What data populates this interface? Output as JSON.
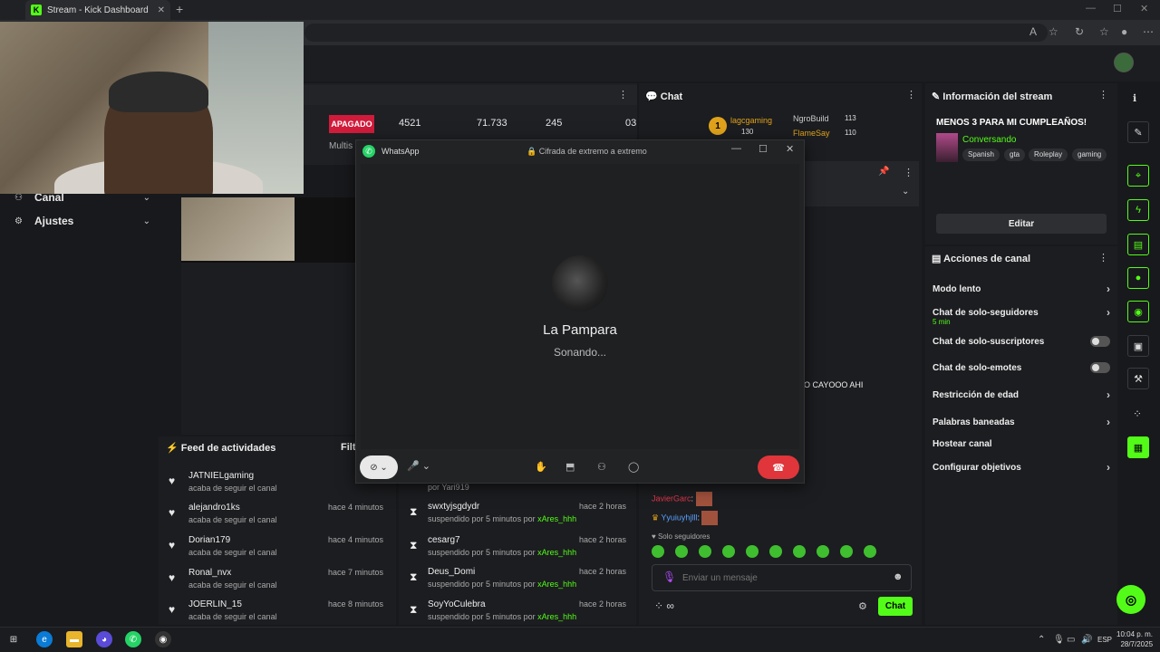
{
  "browser": {
    "tab_title": "Stream - Kick Dashboard",
    "tab_close": "✕",
    "new_tab": "+",
    "win_min": "—",
    "win_max": "☐",
    "win_close": "✕",
    "tool_icons": [
      "A",
      "☆",
      "↻",
      "☆",
      "●",
      "⋯"
    ]
  },
  "sidebar": {
    "items": [
      {
        "icon": "user-group-icon",
        "glyph": "⚇",
        "label": "Canal",
        "chevron": "⌄"
      },
      {
        "icon": "gear-icon",
        "glyph": "⚙",
        "label": "Ajustes",
        "chevron": "⌄"
      }
    ]
  },
  "stream_strip": {
    "status": "APAGADO",
    "multi": "Multis",
    "stats": [
      "4521",
      "71.733",
      "245",
      "03"
    ],
    "edge_letter": "e"
  },
  "activity_feed": {
    "title": "Feed de actividades",
    "filter": "Filt",
    "items": [
      {
        "name": "JATNIELgaming",
        "sub": "acaba de seguir el canal",
        "time": "hace"
      },
      {
        "name": "alejandro1ks",
        "sub": "acaba de seguir el canal",
        "time": "hace 4 minutos"
      },
      {
        "name": "Dorian179",
        "sub": "acaba de seguir el canal",
        "time": "hace 4 minutos"
      },
      {
        "name": "Ronal_nvx",
        "sub": "acaba de seguir el canal",
        "time": "hace 7 minutos"
      },
      {
        "name": "JOERLIN_15",
        "sub": "acaba de seguir el canal",
        "time": "hace 8 minutos"
      }
    ]
  },
  "mod_feed": {
    "partial": "por Yari919",
    "items": [
      {
        "name": "swxtyjsgdydr",
        "sub": "suspendido por 5 minutos por ",
        "by": "xAres_hhh",
        "time": "hace 2 horas"
      },
      {
        "name": "cesarg7",
        "sub": "suspendido por 5 minutos por ",
        "by": "xAres_hhh",
        "time": "hace 2 horas"
      },
      {
        "name": "Deus_Domi",
        "sub": "suspendido por 5 minutos por ",
        "by": "xAres_hhh",
        "time": "hace 2 horas"
      },
      {
        "name": "SoyYoCulebra",
        "sub": "suspendido por 5 minutos por ",
        "by": "xAres_hhh",
        "time": "hace 2 horas"
      }
    ]
  },
  "chat": {
    "title": "Chat",
    "leaderboard": [
      {
        "name": "lagcgaming",
        "count": "130"
      },
      {
        "name": "NgroBuild",
        "count": "113"
      },
      {
        "name": "FlameSay",
        "count": "110"
      }
    ],
    "rank_badge": "1",
    "message_fragment": "O CAYOOO AHI",
    "lines": [
      {
        "user": "JavierGarc",
        "text": ":"
      },
      {
        "user": "Yyuiuyhjlll",
        "text": ":"
      }
    ],
    "solo": "♥ Solo seguidores",
    "input_placeholder": "Enviar un mensaje",
    "send_label": "Chat",
    "infinity": "∞",
    "colors": {
      "accent": "#53fc18",
      "javier": "#e0354b",
      "yyu": "#5aa0ff"
    }
  },
  "stream_info": {
    "title": "Información del stream",
    "stream_title": "MENOS 3 PARA MI CUMPLEAÑOS!",
    "category": "Conversando",
    "tags": [
      "Spanish",
      "gta",
      "Roleplay",
      "gaming"
    ],
    "edit_label": "Editar"
  },
  "channel_actions": {
    "title": "Acciones de canal",
    "items": [
      {
        "label": "Modo lento",
        "control": "chevron"
      },
      {
        "label": "Chat de solo-seguidores",
        "control": "chevron",
        "note": "5 min"
      },
      {
        "label": "Chat de solo-suscriptores",
        "control": "toggle"
      },
      {
        "label": "Chat de solo-emotes",
        "control": "toggle"
      },
      {
        "label": "Restricción de edad",
        "control": "chevron"
      },
      {
        "label": "Palabras baneadas",
        "control": "chevron"
      },
      {
        "label": "Hostear canal",
        "control": "none"
      },
      {
        "label": "Configurar objetivos",
        "control": "chevron"
      }
    ]
  },
  "rail": {
    "icons": [
      {
        "name": "info-icon",
        "glyph": "ℹ"
      },
      {
        "name": "pencil-icon",
        "glyph": "✎"
      },
      {
        "name": "focus-icon",
        "glyph": "⌖"
      },
      {
        "name": "lightning-icon",
        "glyph": "ϟ"
      },
      {
        "name": "document-icon",
        "glyph": "▤"
      },
      {
        "name": "chat-bubble-icon",
        "glyph": "●"
      },
      {
        "name": "broadcast-icon",
        "glyph": "◉"
      },
      {
        "name": "layout-icon",
        "glyph": "▣"
      },
      {
        "name": "wrench-icon",
        "glyph": "⚒"
      },
      {
        "name": "dots-icon",
        "glyph": "⁘"
      },
      {
        "name": "clapper-icon",
        "glyph": "▦"
      }
    ],
    "help_glyph": "◎"
  },
  "whatsapp": {
    "app_name": "WhatsApp",
    "encryption": "🔒 Cifrada de extremo a extremo",
    "contact": "La Pampara",
    "status": "Sonando...",
    "hangup_glyph": "☎"
  },
  "taskbar": {
    "time": "10:04 p. m.",
    "date": "28/7/2025",
    "lang": "ESP"
  }
}
